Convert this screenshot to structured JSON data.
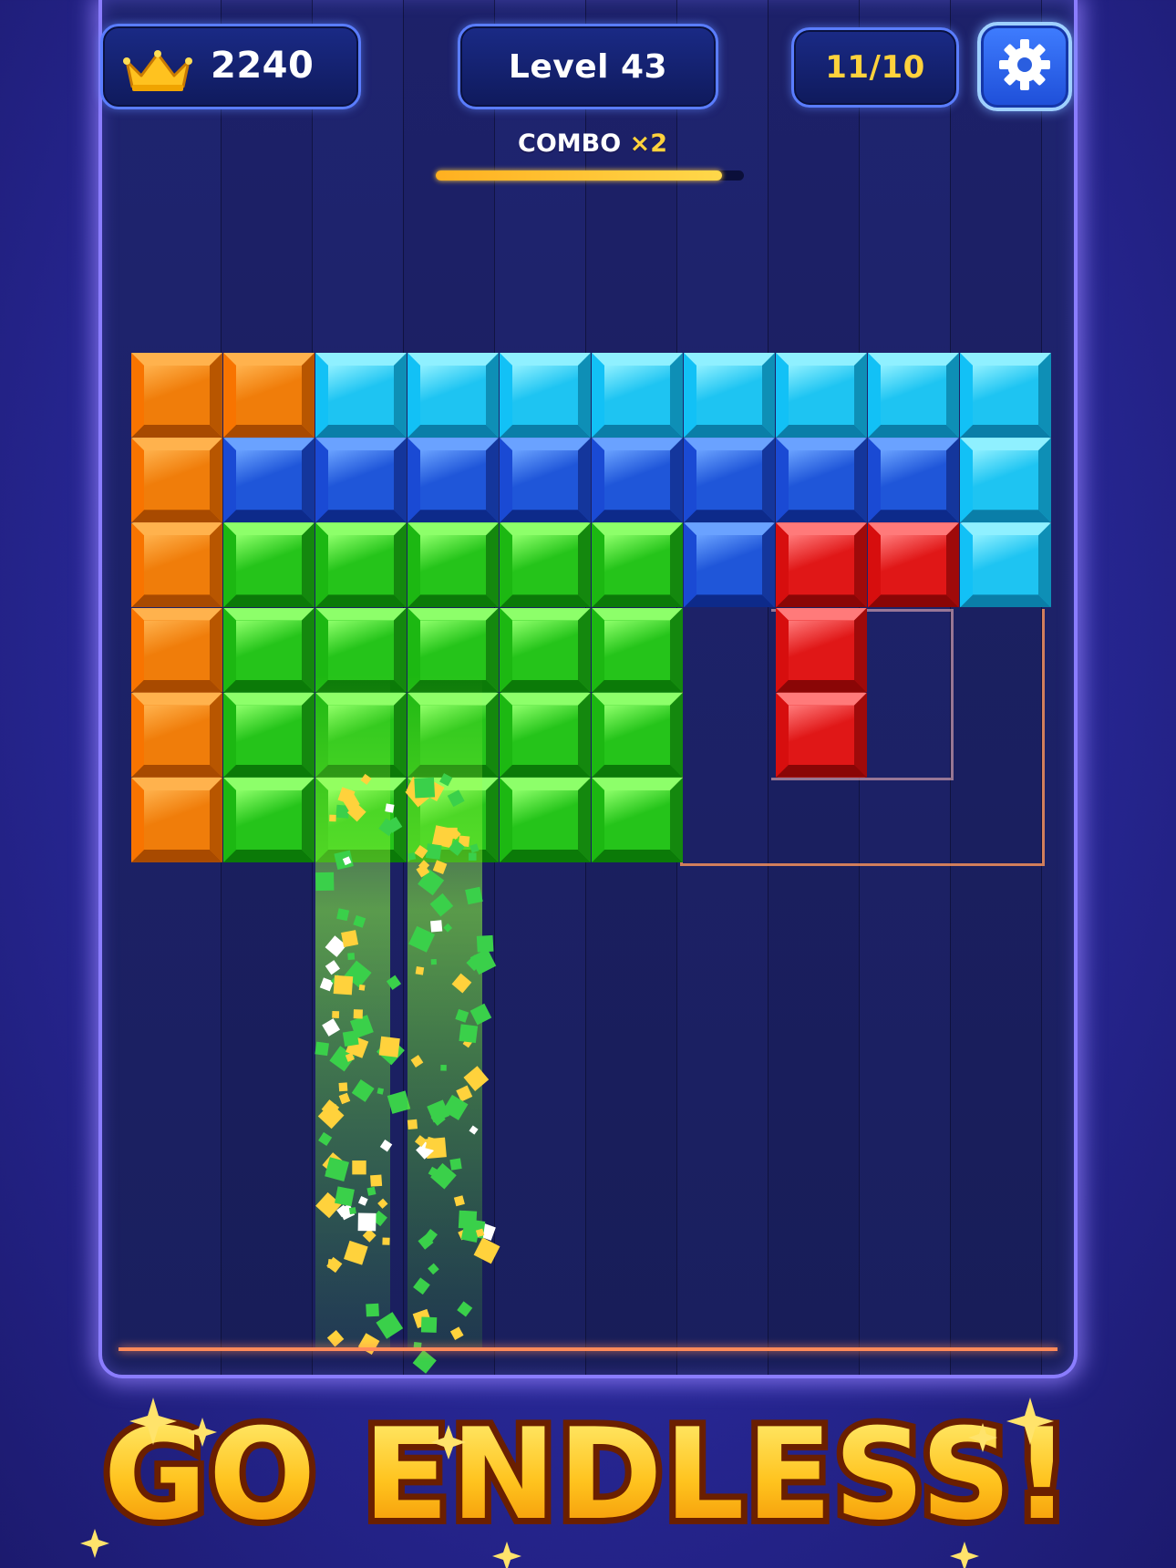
{
  "hud": {
    "score": "2240",
    "level": "Level 43",
    "moves": "11/10"
  },
  "combo": {
    "label": "COMBO",
    "multiplier": "×2",
    "progress": 0.93
  },
  "banner": {
    "title": "GO ENDLESS!"
  },
  "colors": {
    "orange": "#f07d0a",
    "cyan": "#1ec4f2",
    "blue": "#1f56d9",
    "green": "#25c41a",
    "red": "#e01717",
    "accent_gold": "#ffd23c"
  },
  "board": {
    "columns": 10,
    "rows": 6,
    "grid": [
      [
        "O",
        "O",
        "C",
        "C",
        "C",
        "C",
        "C",
        "C",
        "C",
        "C"
      ],
      [
        "O",
        "B",
        "B",
        "B",
        "B",
        "B",
        "B",
        "B",
        "B",
        "C"
      ],
      [
        "O",
        "G",
        "G",
        "G",
        "G",
        "G",
        "B",
        "R",
        "R",
        "C"
      ],
      [
        "O",
        "G",
        "G",
        "G",
        "G",
        "G",
        "",
        "R",
        "",
        ""
      ],
      [
        "O",
        "G",
        "G",
        "G",
        "G",
        "G",
        "",
        "R",
        "",
        ""
      ],
      [
        "O",
        "G",
        "G",
        "G",
        "G",
        "G",
        "",
        "",
        "",
        ""
      ]
    ],
    "clearing_columns": [
      2,
      3
    ]
  },
  "icons": {
    "score": "crown-icon",
    "settings": "gear-icon"
  }
}
